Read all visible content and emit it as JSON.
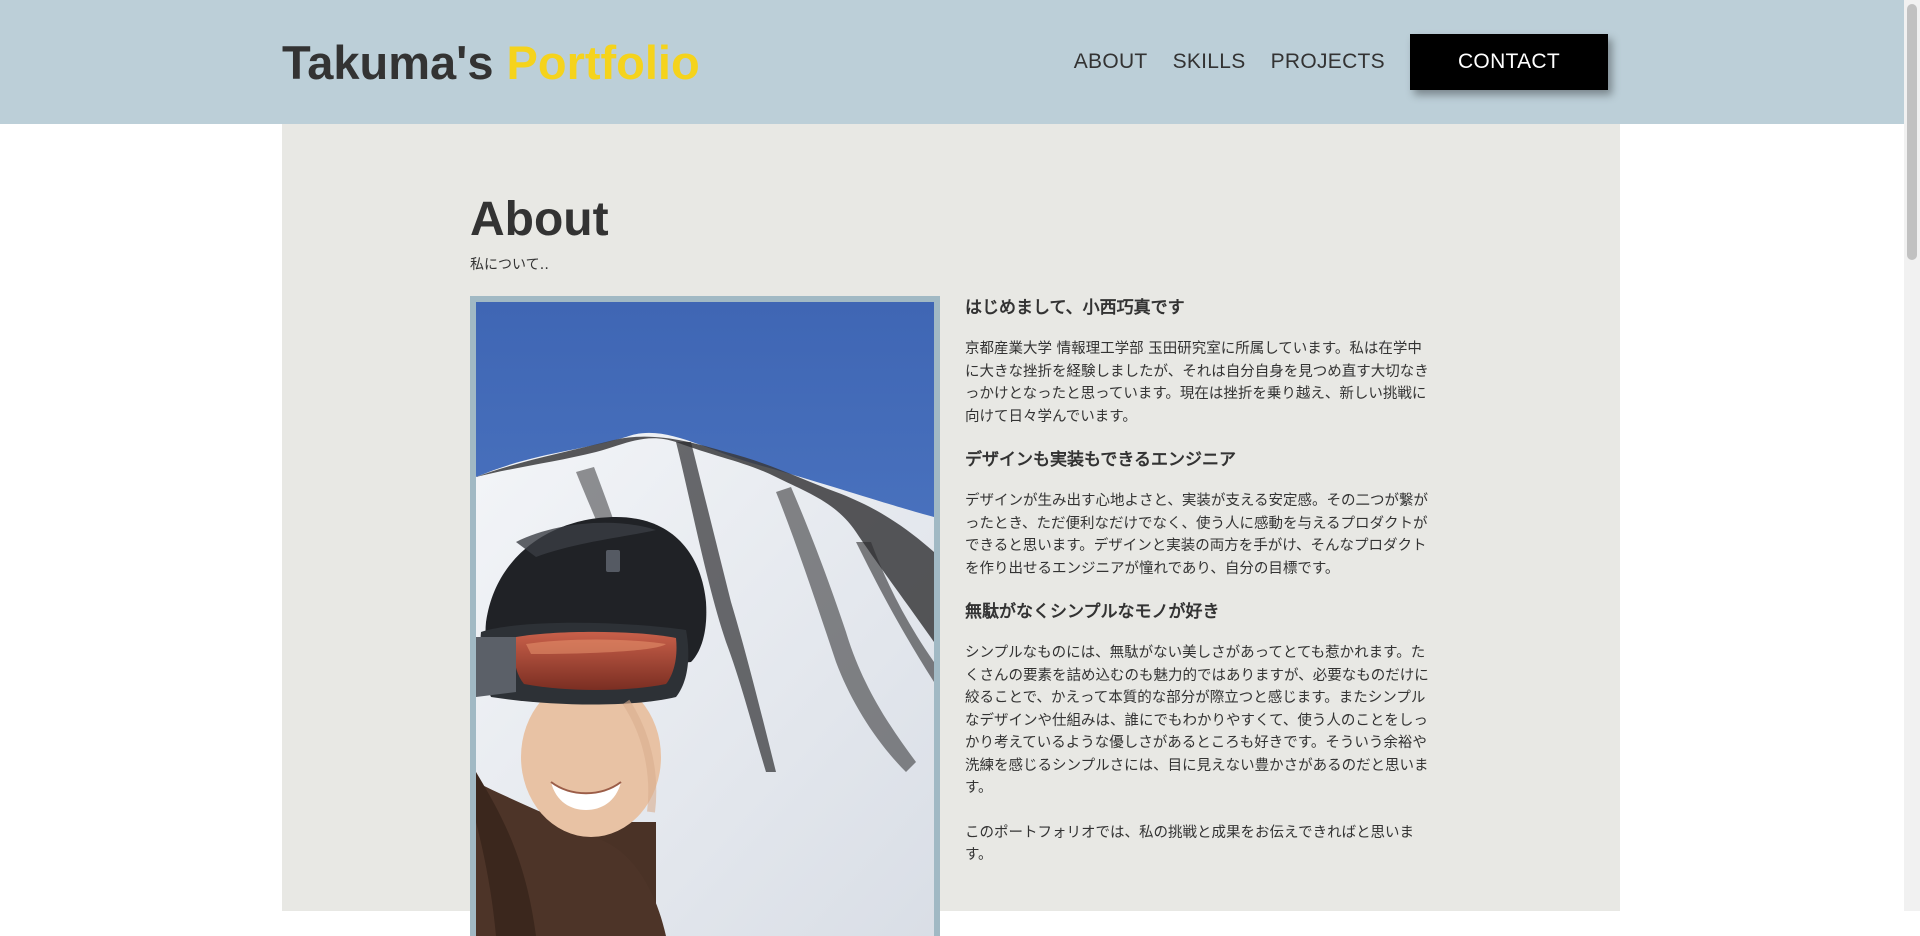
{
  "header": {
    "logo_name": "Takuma's ",
    "logo_accent": "Portfolio",
    "nav": {
      "about": "ABOUT",
      "skills": "SKILLS",
      "projects": "PROJECTS",
      "contact": "CONTACT"
    },
    "colors": {
      "header_bg": "#bccfd8",
      "accent": "#f5d31c",
      "contact_bg": "#000000"
    }
  },
  "about": {
    "title": "About",
    "subtitle": "私について‥",
    "photo_icon": "skier-selfie-photo",
    "sections": [
      {
        "heading": "はじめまして、小西巧真です",
        "body": "京都産業大学 情報理工学部 玉田研究室に所属しています。私は在学中に大きな挫折を経験しましたが、それは自分自身を見つめ直す大切なきっかけとなったと思っています。現在は挫折を乗り越え、新しい挑戦に向けて日々学んでいます。"
      },
      {
        "heading": "デザインも実装もできるエンジニア",
        "body": "デザインが生み出す心地よさと、実装が支える安定感。その二つが繋がったとき、ただ便利なだけでなく、使う人に感動を与えるプロダクトができると思います。デザインと実装の両方を手がけ、そんなプロダクトを作り出せるエンジニアが憧れであり、自分の目標です。"
      },
      {
        "heading": "無駄がなくシンプルなモノが好き",
        "body": "シンプルなものには、無駄がない美しさがあってとても惹かれます。たくさんの要素を詰め込むのも魅力的ではありますが、必要なものだけに絞ることで、かえって本質的な部分が際立つと感じます。またシンプルなデザインや仕組みは、誰にでもわかりやすくて、使う人のことをしっかり考えているような優しさがあるところも好きです。そういう余裕や洗練を感じるシンプルさには、目に見えない豊かさがあるのだと思います。"
      }
    ],
    "closing": "このポートフォリオでは、私の挑戦と成果をお伝えできればと思います。"
  }
}
